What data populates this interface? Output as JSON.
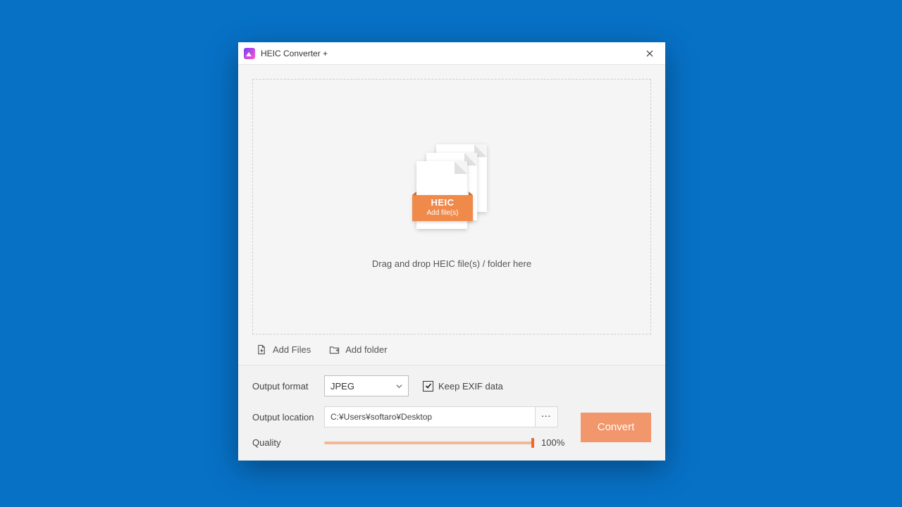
{
  "window": {
    "title": "HEIC Converter +"
  },
  "dropzone": {
    "tag_title": "HEIC",
    "tag_sub": "Add file(s)",
    "instruction": "Drag and drop HEIC file(s) / folder here"
  },
  "actions": {
    "add_files": "Add Files",
    "add_folder": "Add folder"
  },
  "settings": {
    "output_format_label": "Output format",
    "output_format_value": "JPEG",
    "keep_exif_label": "Keep EXIF data",
    "keep_exif_checked": true,
    "output_location_label": "Output location",
    "output_location_value": "C:¥Users¥softaro¥Desktop",
    "browse_label": "···",
    "quality_label": "Quality",
    "quality_value": "100%",
    "convert_label": "Convert"
  }
}
